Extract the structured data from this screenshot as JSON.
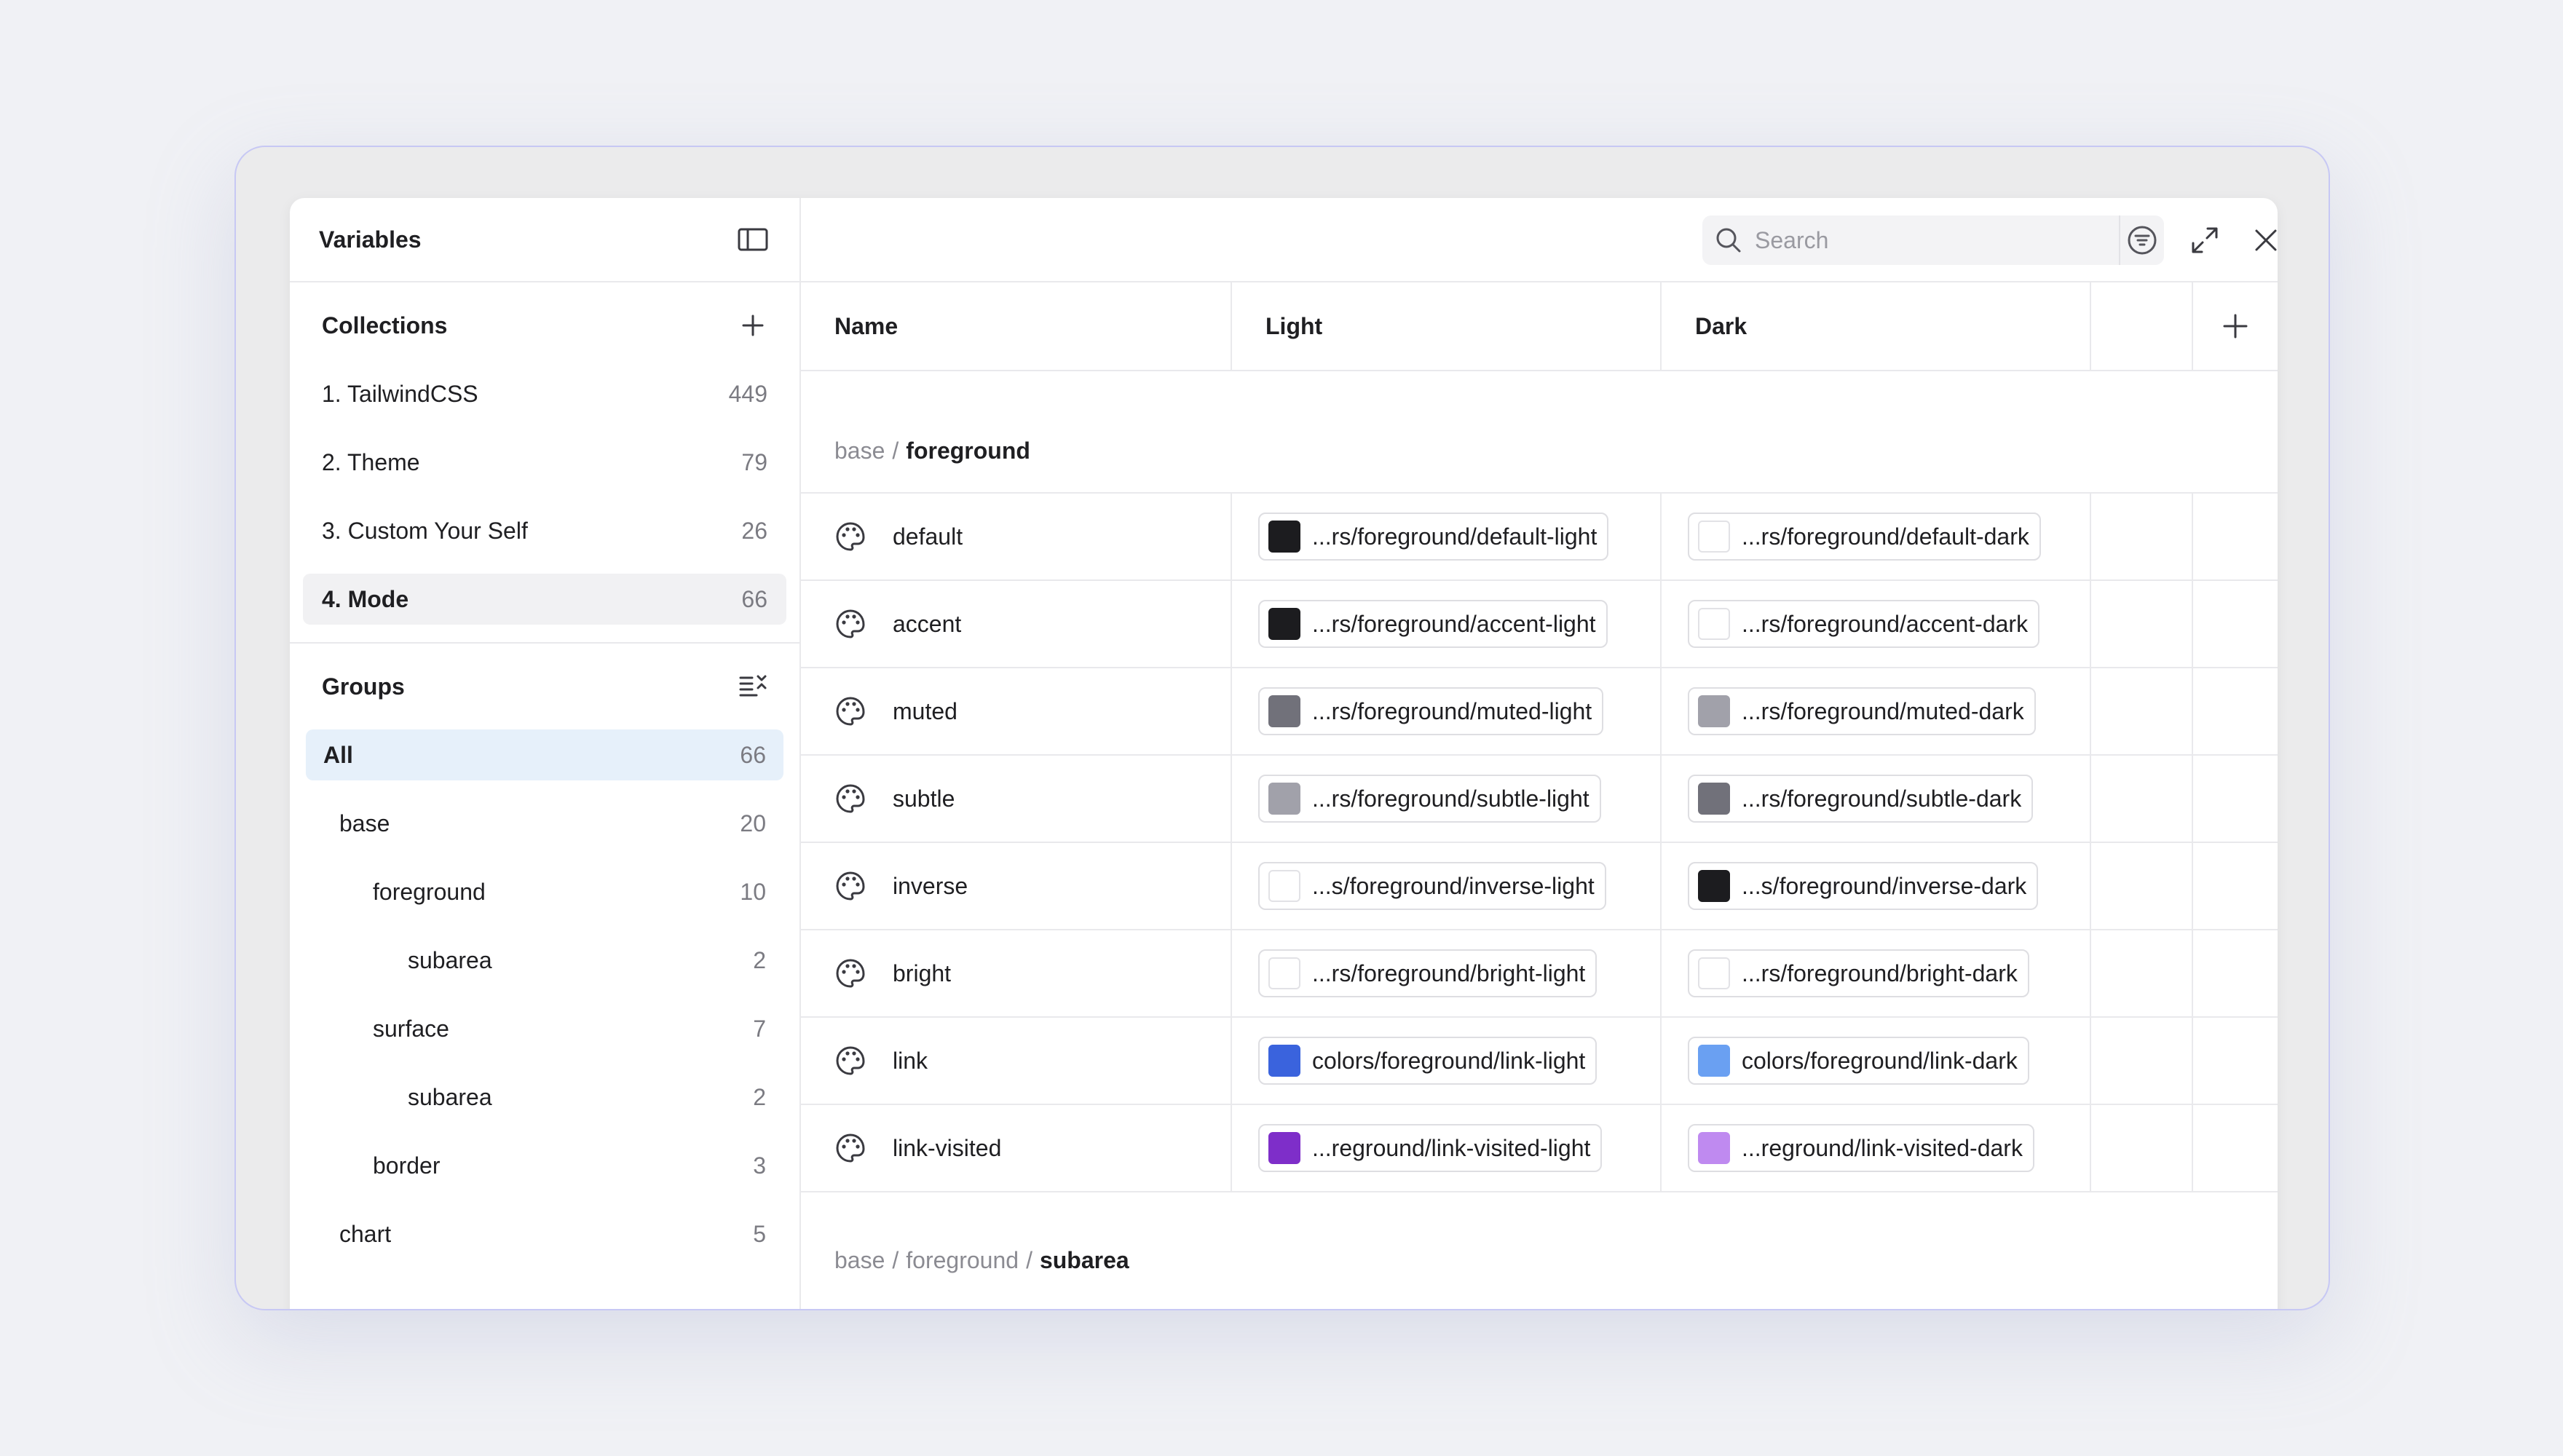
{
  "sidebar": {
    "title": "Variables",
    "collections_title": "Collections",
    "collections": [
      {
        "label": "1. TailwindCSS",
        "count": "449"
      },
      {
        "label": "2. Theme",
        "count": "79"
      },
      {
        "label": "3. Custom Your Self",
        "count": "26"
      },
      {
        "label": "4. Mode",
        "count": "66"
      }
    ],
    "groups_title": "Groups",
    "groups": [
      {
        "label": "All",
        "count": "66"
      },
      {
        "label": "base",
        "count": "20"
      },
      {
        "label": "foreground",
        "count": "10"
      },
      {
        "label": "subarea",
        "count": "2"
      },
      {
        "label": "surface",
        "count": "7"
      },
      {
        "label": "subarea",
        "count": "2"
      },
      {
        "label": "border",
        "count": "3"
      },
      {
        "label": "chart",
        "count": "5"
      }
    ]
  },
  "search": {
    "placeholder": "Search"
  },
  "table": {
    "headers": {
      "name": "Name",
      "light": "Light",
      "dark": "Dark"
    },
    "group1": {
      "base": "base",
      "sep": "/",
      "leaf": "foreground"
    },
    "rows": [
      {
        "name": "default",
        "light": "...rs/foreground/default-light",
        "light_color": "#1c1c1f",
        "dark": "...rs/foreground/default-dark",
        "dark_color": "#ffffff"
      },
      {
        "name": "accent",
        "light": "...rs/foreground/accent-light",
        "light_color": "#1c1c1f",
        "dark": "...rs/foreground/accent-dark",
        "dark_color": "#ffffff"
      },
      {
        "name": "muted",
        "light": "...rs/foreground/muted-light",
        "light_color": "#71717a",
        "dark": "...rs/foreground/muted-dark",
        "dark_color": "#a1a1aa"
      },
      {
        "name": "subtle",
        "light": "...rs/foreground/subtle-light",
        "light_color": "#a1a1aa",
        "dark": "...rs/foreground/subtle-dark",
        "dark_color": "#71717a"
      },
      {
        "name": "inverse",
        "light": "...s/foreground/inverse-light",
        "light_color": "#ffffff",
        "dark": "...s/foreground/inverse-dark",
        "dark_color": "#1c1c1f"
      },
      {
        "name": "bright",
        "light": "...rs/foreground/bright-light",
        "light_color": "#ffffff",
        "dark": "...rs/foreground/bright-dark",
        "dark_color": "#ffffff"
      },
      {
        "name": "link",
        "light": "colors/foreground/link-light",
        "light_color": "#3a63dd",
        "dark": "colors/foreground/link-dark",
        "dark_color": "#6aa0f2"
      },
      {
        "name": "link-visited",
        "light": "...reground/link-visited-light",
        "light_color": "#7e2ec9",
        "dark": "...reground/link-visited-dark",
        "dark_color": "#bf8af0"
      }
    ],
    "group2": {
      "base": "base",
      "sep1": "/",
      "mid": "foreground",
      "sep2": "/",
      "leaf": "subarea"
    }
  }
}
